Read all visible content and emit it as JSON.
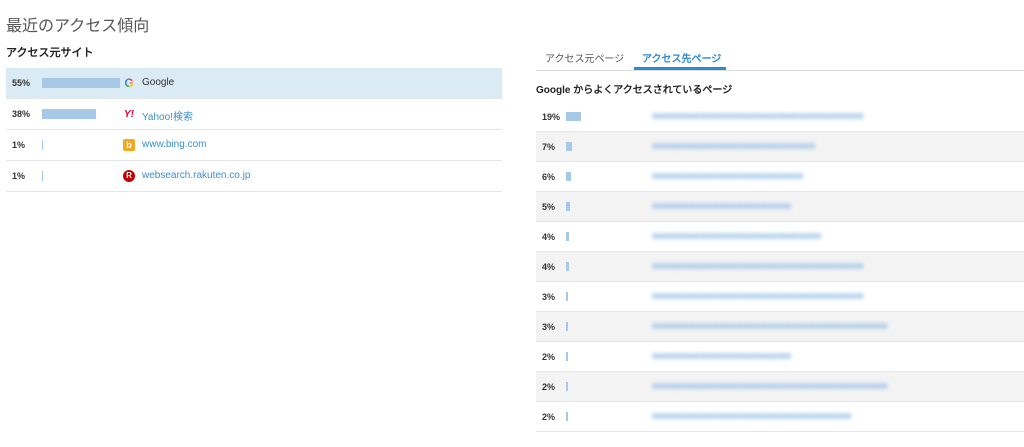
{
  "page": {
    "title": "最近のアクセス傾向"
  },
  "sources": {
    "title": "アクセス元サイト",
    "rows": [
      {
        "percent": "55%",
        "value": 55,
        "icon": "google-icon",
        "label": "Google"
      },
      {
        "percent": "38%",
        "value": 38,
        "icon": "yahoo-icon",
        "label": "Yahoo!検索"
      },
      {
        "percent": "1%",
        "value": 1,
        "icon": "bing-icon",
        "label": "www.bing.com"
      },
      {
        "percent": "1%",
        "value": 1,
        "icon": "rakuten-icon",
        "label": "websearch.rakuten.co.jp"
      }
    ]
  },
  "tabs": [
    {
      "label": "アクセス元ページ",
      "active": false
    },
    {
      "label": "アクセス先ページ",
      "active": true
    }
  ],
  "destinations": {
    "title": "Google からよくアクセスされているページ",
    "rows": [
      {
        "percent": "19%",
        "value": 19,
        "label": "■■■■■■■■■■■■■■■■■■■■■■■■■■■■■■■■■■■"
      },
      {
        "percent": "7%",
        "value": 7,
        "label": "■■■■■■■■■■■■■■■■■■■■■■■■■■■"
      },
      {
        "percent": "6%",
        "value": 6,
        "label": "■■■■■■■■■■■■■■■■■■■■■■■■■"
      },
      {
        "percent": "5%",
        "value": 5,
        "label": "■■■■■■■■■■■■■■■■■■■■■■■"
      },
      {
        "percent": "4%",
        "value": 4,
        "label": "■■■■■■■■■■■■■■■■■■■■■■■■■■■■"
      },
      {
        "percent": "4%",
        "value": 4,
        "label": "■■■■■■■■■■■■■■■■■■■■■■■■■■■■■■■■■■■"
      },
      {
        "percent": "3%",
        "value": 3,
        "label": "■■■■■■■■■■■■■■■■■■■■■■■■■■■■■■■■■■■"
      },
      {
        "percent": "3%",
        "value": 3,
        "label": "■■■■■■■■■■■■■■■■■■■■■■■■■■■■■■■■■■■■■■■"
      },
      {
        "percent": "2%",
        "value": 2,
        "label": "■■■■■■■■■■■■■■■■■■■■■■■"
      },
      {
        "percent": "2%",
        "value": 2,
        "label": "■■■■■■■■■■■■■■■■■■■■■■■■■■■■■■■■■■■■■■■"
      },
      {
        "percent": "2%",
        "value": 2,
        "label": "■■■■■■■■■■■■■■■■■■■■■■■■■■■■■■■■■"
      }
    ]
  }
}
